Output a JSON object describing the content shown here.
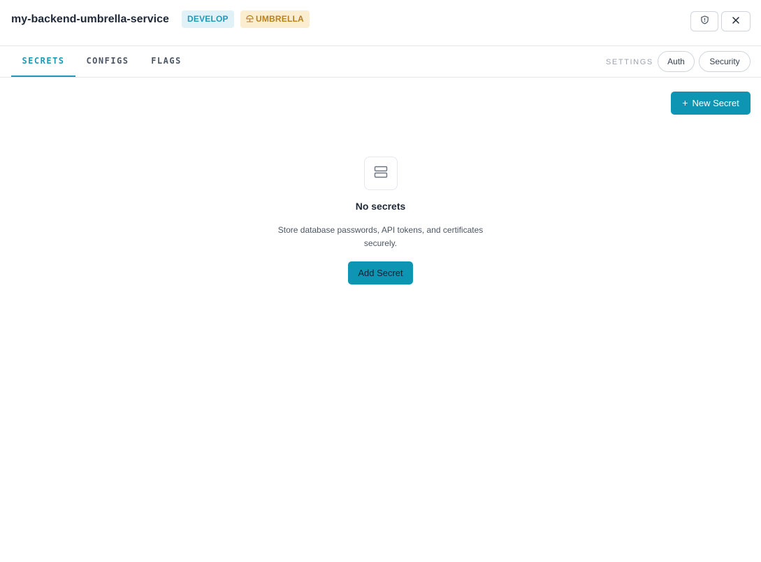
{
  "header": {
    "title": "my-backend-umbrella-service",
    "env_badge": "DEVELOP",
    "type_badge": "UMBRELLA",
    "type_badge_icon": "umbrella-icon",
    "shield_icon": "shield-icon",
    "close_icon": "close-icon"
  },
  "tabs": [
    {
      "label": "SECRETS",
      "active": true
    },
    {
      "label": "CONFIGS",
      "active": false
    },
    {
      "label": "FLAGS",
      "active": false
    }
  ],
  "settings": {
    "label": "SETTINGS",
    "buttons": [
      "Auth",
      "Security"
    ]
  },
  "toolbar": {
    "new_label": "New Secret",
    "new_icon": "+"
  },
  "empty_state": {
    "icon": "database-icon",
    "title": "No secrets",
    "description": "Store database passwords, API tokens, and certificates securely.",
    "action_label": "Add Secret"
  },
  "colors": {
    "accent": "#0e95b3",
    "env_badge_bg": "#e0f2f7",
    "env_badge_fg": "#1d9ab8",
    "type_badge_bg": "#fbedcf",
    "type_badge_fg": "#b8811e"
  }
}
